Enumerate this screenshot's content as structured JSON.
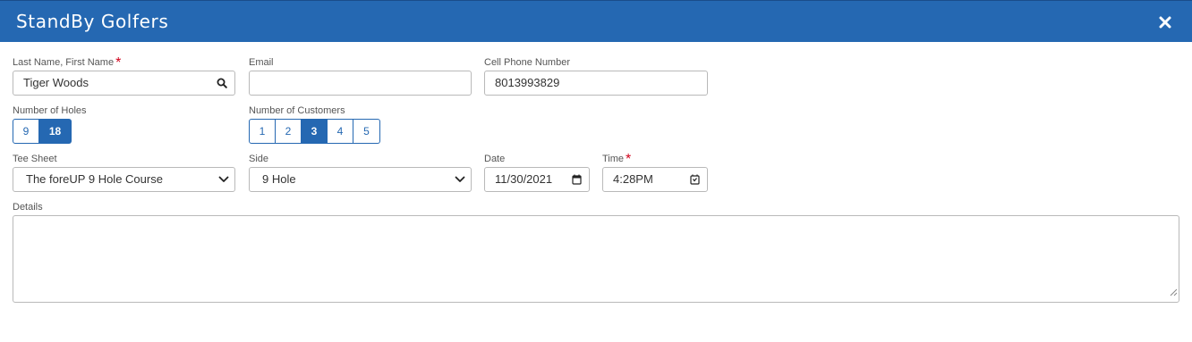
{
  "header": {
    "title": "StandBy Golfers",
    "close_icon": "close-icon"
  },
  "fields": {
    "name": {
      "label": "Last Name, First Name",
      "required_mark": "*",
      "value": "Tiger Woods",
      "icon": "search-icon"
    },
    "email": {
      "label": "Email",
      "value": ""
    },
    "phone": {
      "label": "Cell Phone Number",
      "value": "8013993829"
    },
    "holes": {
      "label": "Number of Holes",
      "options": [
        "9",
        "18"
      ],
      "selected": "18"
    },
    "customers": {
      "label": "Number of Customers",
      "options": [
        "1",
        "2",
        "3",
        "4",
        "5"
      ],
      "selected": "3"
    },
    "tee_sheet": {
      "label": "Tee Sheet",
      "value": "The foreUP 9 Hole Course",
      "icon": "chevron-down-icon"
    },
    "side": {
      "label": "Side",
      "value": "9 Hole",
      "icon": "chevron-down-icon"
    },
    "date": {
      "label": "Date",
      "value": "11/30/2021",
      "icon": "calendar-icon"
    },
    "time": {
      "label": "Time",
      "required_mark": "*",
      "value": "4:28PM",
      "icon": "calendar-clock-icon"
    },
    "details": {
      "label": "Details",
      "value": ""
    }
  },
  "colors": {
    "header": "#2568b2",
    "accent": "#2568b2",
    "required": "#d0021b"
  }
}
